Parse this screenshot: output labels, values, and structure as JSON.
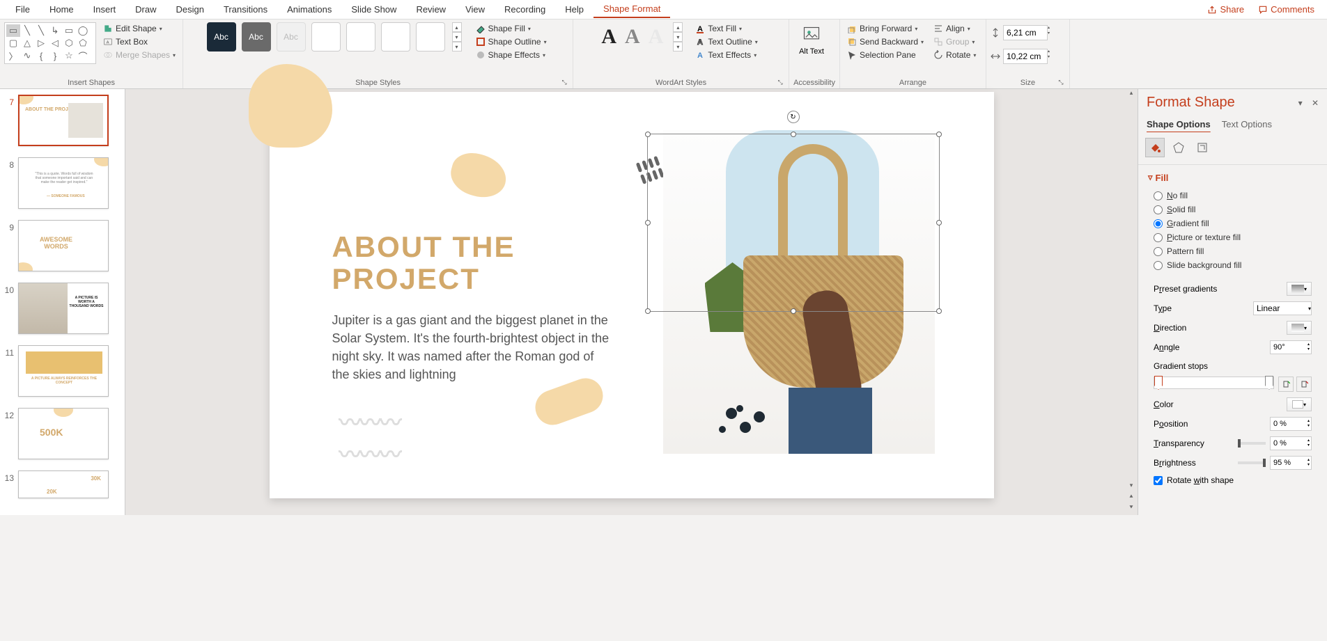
{
  "menu": {
    "file": "File",
    "home": "Home",
    "insert": "Insert",
    "draw": "Draw",
    "design": "Design",
    "transitions": "Transitions",
    "animations": "Animations",
    "slideshow": "Slide Show",
    "review": "Review",
    "view": "View",
    "recording": "Recording",
    "help": "Help",
    "shape_format": "Shape Format",
    "share": "Share",
    "comments": "Comments"
  },
  "ribbon": {
    "edit_shape": "Edit Shape",
    "text_box": "Text Box",
    "merge_shapes": "Merge Shapes",
    "insert_shapes": "Insert Shapes",
    "shape_styles": "Shape Styles",
    "shape_fill": "Shape Fill",
    "shape_outline": "Shape Outline",
    "shape_effects": "Shape Effects",
    "abc": "Abc",
    "wordart_styles": "WordArt Styles",
    "text_fill": "Text Fill",
    "text_outline": "Text Outline",
    "text_effects": "Text Effects",
    "alt_text": "Alt Text",
    "alt_text_line2": "",
    "accessibility": "Accessibility",
    "bring_forward": "Bring Forward",
    "send_backward": "Send Backward",
    "selection_pane": "Selection Pane",
    "align": "Align",
    "group": "Group",
    "rotate": "Rotate",
    "arrange": "Arrange",
    "size": "Size",
    "height": "6,21 cm",
    "width": "10,22 cm",
    "wa_glyph": "A"
  },
  "thumbs": {
    "n7": "7",
    "n8": "8",
    "n9": "9",
    "n10": "10",
    "n11": "11",
    "n12": "12",
    "n13": "13",
    "t7a": "ABOUT THE PROJECT",
    "t8a": "\"This is a quote. Words full of wisdom that someone important said and can make the reader get inspired.\"",
    "t8b": "— SOMEONE FAMOUS",
    "t9a": "AWESOME",
    "t9b": "WORDS",
    "t10a": "A PICTURE IS WORTH A THOUSAND WORDS",
    "t11a": "A PICTURE ALWAYS REINFORCES THE CONCEPT",
    "t12a": "500K",
    "t13a": "30K",
    "t13b": "20K"
  },
  "slide": {
    "title1": "ABOUT THE",
    "title2": "PROJECT",
    "body": "Jupiter is a gas giant and the biggest planet in the Solar System. It's the fourth-brightest object in the night sky. It was named after the Roman god of the skies and lightning"
  },
  "pane": {
    "title": "Format Shape",
    "shape_options": "Shape Options",
    "text_options": "Text Options",
    "fill": "Fill",
    "no_fill": "o fill",
    "solid_fill": "olid fill",
    "gradient_fill": "radient fill",
    "picture_fill": "icture or texture fill",
    "pattern_fill": "Pattern fill",
    "slide_bg_fill": "Slide background fill",
    "preset_gradients": "reset gradients",
    "type": "pe",
    "type_value": "Linear",
    "direction": "irection",
    "angle": "ngle",
    "angle_value": "90°",
    "gradient_stops": "Gradient stops",
    "color": "olor",
    "position": "osition",
    "position_value": "0 %",
    "transparency": "ransparency",
    "transparency_value": "0 %",
    "brightness": "rightness",
    "brightness_value": "95 %",
    "rotate_with_shape": "ith shape"
  },
  "colors": {
    "accent": "#c43e1c",
    "beige": "#f5d9a8",
    "title": "#d2a86a"
  }
}
